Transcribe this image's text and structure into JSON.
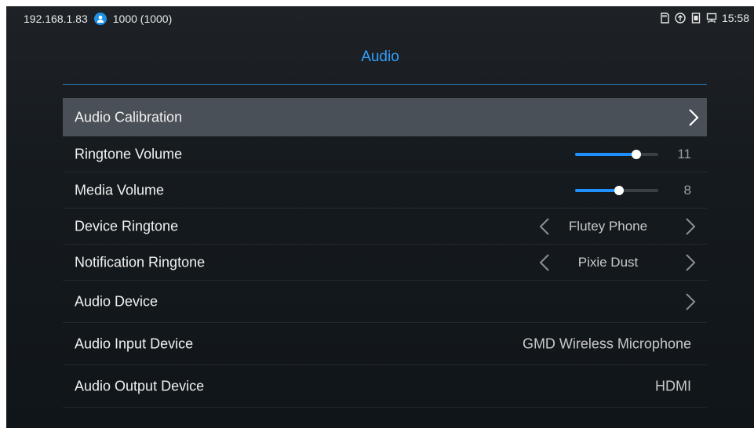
{
  "status": {
    "ip": "192.168.1.83",
    "account": "1000 (1000)",
    "time": "15:58",
    "icons": [
      "sd-card-icon",
      "upload-icon",
      "sim-icon",
      "network-icon"
    ]
  },
  "page": {
    "title": "Audio"
  },
  "rows": {
    "audio_calibration": {
      "label": "Audio Calibration"
    },
    "ringtone_volume": {
      "label": "Ringtone Volume",
      "value": "11",
      "level": 11,
      "max": 15
    },
    "media_volume": {
      "label": "Media Volume",
      "value": "8",
      "level": 8,
      "max": 15
    },
    "device_ringtone": {
      "label": "Device Ringtone",
      "value": "Flutey Phone"
    },
    "notification_ringtone": {
      "label": "Notification Ringtone",
      "value": "Pixie Dust"
    },
    "audio_device": {
      "label": "Audio Device"
    },
    "audio_input_device": {
      "label": "Audio Input Device",
      "value": "GMD Wireless Microphone"
    },
    "audio_output_device": {
      "label": "Audio Output Device",
      "value": "HDMI"
    }
  },
  "colors": {
    "accent": "#31a0ff",
    "slider": "#1e90ff",
    "selected_row": "#4a5058",
    "background": "#151a1e"
  }
}
